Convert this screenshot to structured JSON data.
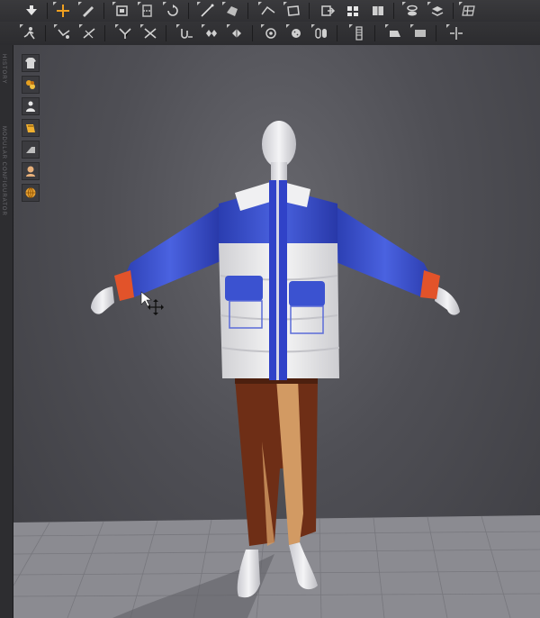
{
  "window": {
    "left_panel_labels": [
      "HISTORY",
      "MODULAR CONFIGURATOR"
    ]
  },
  "toolbar_row1": {
    "icons": [
      "download-arrow-icon",
      "move-cross-icon",
      "edit-pattern-icon",
      "transform-icon",
      "fold-icon",
      "rotate-icon",
      "line-icon",
      "polygon-icon",
      "segment-icon",
      "rectangle-icon",
      "export-icon",
      "fabric-icon",
      "button-icon",
      "zipper-icon",
      "grid-icon"
    ]
  },
  "toolbar_row2": {
    "icons": [
      "simulate-avatar-icon",
      "pin-icon",
      "needle-icon",
      "sew-icon",
      "free-sew-icon",
      "tack-icon",
      "pattern-pieces-icon",
      "puzzle-icon",
      "select-mesh-icon",
      "button-add-icon",
      "buttonhole-icon",
      "snap-icon",
      "zipper-tool-icon",
      "elastic-icon",
      "trim-icon",
      "align-icon"
    ]
  },
  "viewport_tools": [
    "garment-icon",
    "fabric-swatch-icon",
    "avatar-icon",
    "stitch-icon",
    "fold-tool-icon",
    "avatar-head-icon",
    "globe-icon"
  ],
  "colors": {
    "jacket_blue": "#3a4fcf",
    "jacket_white": "#ededed",
    "cuff_orange": "#e2532a",
    "pants_brown": "#6e2e16",
    "pants_tan": "#d29a63",
    "floor": "#8a8a90"
  }
}
